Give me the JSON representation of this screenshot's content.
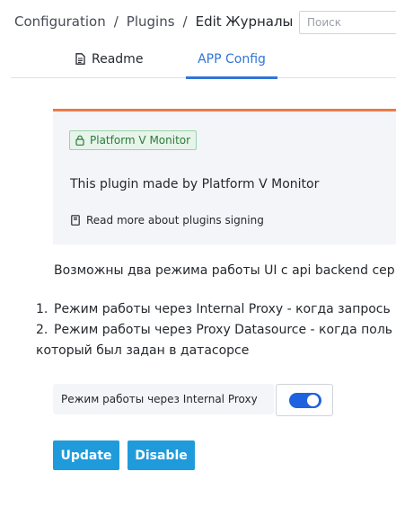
{
  "breadcrumb": {
    "items": [
      "Configuration",
      "Plugins",
      "Edit Журналы"
    ],
    "separator": "/"
  },
  "search": {
    "placeholder": "Поиск",
    "value": ""
  },
  "tabs": [
    {
      "label": "Readme",
      "icon": "doc-icon",
      "active": false
    },
    {
      "label": "APP Config",
      "active": true
    }
  ],
  "info_card": {
    "badge": "Platform V Monitor",
    "badge_icon": "lock-icon",
    "description": "This plugin made by Platform V Monitor",
    "read_more": "Read more about plugins signing",
    "read_more_icon": "book-icon",
    "accent_color": "#eb7b4a"
  },
  "main": {
    "intro": "Возможны два режима работы UI с api backend сер",
    "modes": [
      {
        "number": "1.",
        "text": "Режим работы через Internal Proxy - когда запрось"
      },
      {
        "number": "2.",
        "text": "Режим работы через Proxy Datasource - когда поль",
        "continuation": "который был задан в датасорсе"
      }
    ]
  },
  "switch": {
    "label": "Режим работы через Internal Proxy",
    "on": true,
    "color": "#1f62e0"
  },
  "buttons": {
    "update": "Update",
    "disable": "Disable",
    "color": "#1f9bdc"
  }
}
